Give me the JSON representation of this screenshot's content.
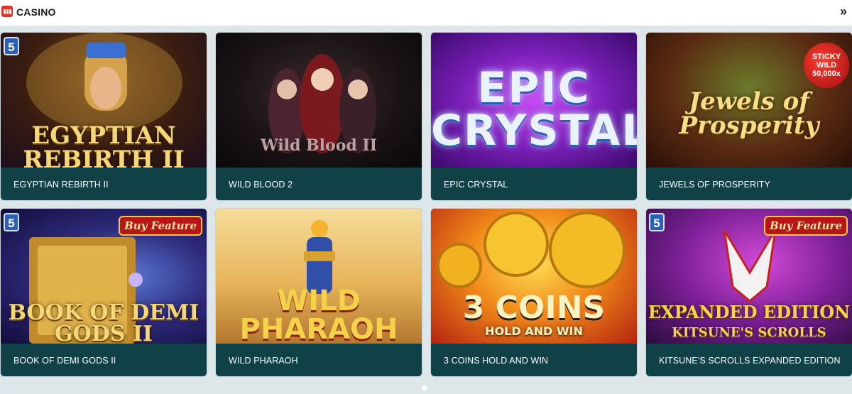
{
  "header": {
    "title": "CASINO",
    "icon": "slot-machine-icon",
    "next_icon": "chevron-right-double-icon",
    "next_glyph": "»"
  },
  "colors": {
    "page_bg": "#dde6e8",
    "card_footer": "#0f4147",
    "label_text": "#ffffff",
    "brand_red": "#e0342f"
  },
  "games": [
    {
      "label": "EGYPTIAN REBIRTH II",
      "art_text": "EGYPTIAN REBIRTH II",
      "badge": "5"
    },
    {
      "label": "WILD BLOOD 2",
      "art_text": "Wild Blood II"
    },
    {
      "label": "EPIC CRYSTAL",
      "art_text": "EPIC CRYSTAL"
    },
    {
      "label": "JEWELS OF PROSPERITY",
      "art_text": "Jewels of Prosperity",
      "sticky_badge": [
        "STICKY",
        "WILD",
        "50,000x"
      ]
    },
    {
      "label": "BOOK OF DEMI GODS II",
      "art_text": "BOOK OF DEMI GODS II",
      "badge": "5",
      "buy_badge": "Buy Feature"
    },
    {
      "label": "WILD PHARAOH",
      "art_text": "WILD PHARAOH"
    },
    {
      "label": "3 COINS HOLD AND WIN",
      "art_text": "3 COINS",
      "art_subtext": "HOLD AND WIN"
    },
    {
      "label": "KITSUNE'S SCROLLS EXPANDED EDITION",
      "art_text": "EXPANDED EDITION",
      "art_subtext": "KITSUNE'S SCROLLS",
      "badge": "5",
      "buy_badge": "Buy Feature"
    }
  ],
  "pagination": {
    "active_index": 0
  }
}
